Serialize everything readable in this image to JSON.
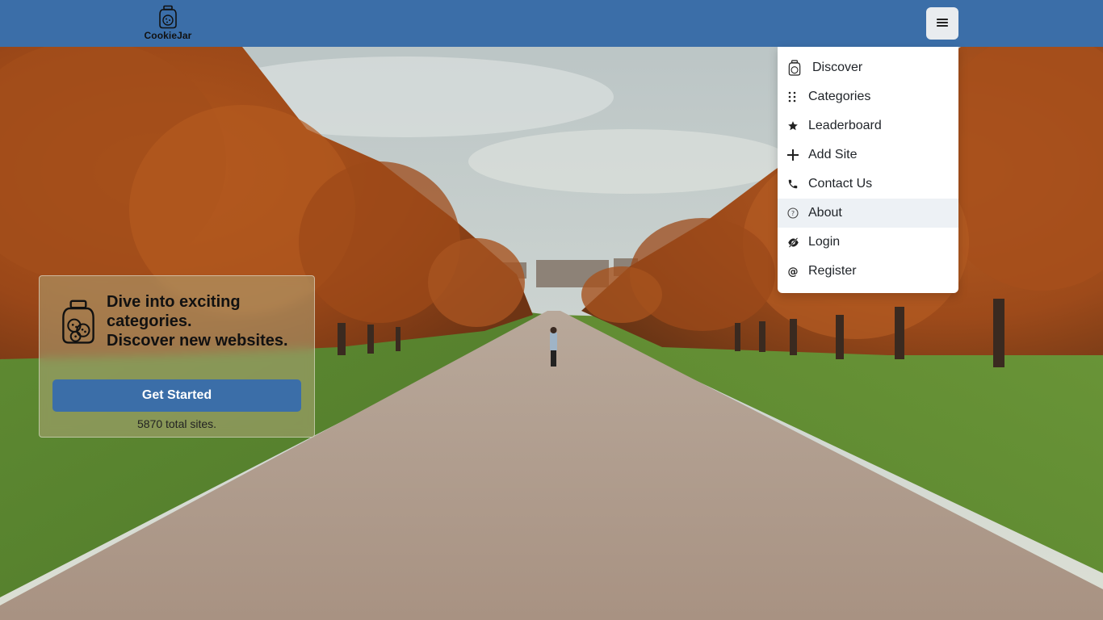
{
  "brand": {
    "name": "CookieJar",
    "logo_icon": "cookie-jar-icon"
  },
  "header": {
    "menu_icon": "hamburger-menu-icon",
    "bg_color": "#3b6ea8"
  },
  "menu": {
    "items": [
      {
        "label": "Discover",
        "icon": "cookie-jar-icon"
      },
      {
        "label": "Categories",
        "icon": "grid-dots-icon"
      },
      {
        "label": "Leaderboard",
        "icon": "star-icon"
      },
      {
        "label": "Add Site",
        "icon": "plus-icon"
      },
      {
        "label": "Contact Us",
        "icon": "phone-icon"
      },
      {
        "label": "About",
        "icon": "question-circle-icon",
        "highlighted": true
      },
      {
        "label": "Login",
        "icon": "eye-slash-icon"
      },
      {
        "label": "Register",
        "icon": "at-sign-icon"
      }
    ]
  },
  "hero": {
    "line1": "Dive into exciting",
    "line2": "categories.",
    "line3": "Discover new websites.",
    "button_label": "Get Started",
    "site_count": "5870 total sites.",
    "icon": "cookie-jar-icon"
  },
  "colors": {
    "accent": "#3b6ea8",
    "menu_button_bg": "#e9ecef",
    "active_item_bg": "#edf1f5"
  }
}
